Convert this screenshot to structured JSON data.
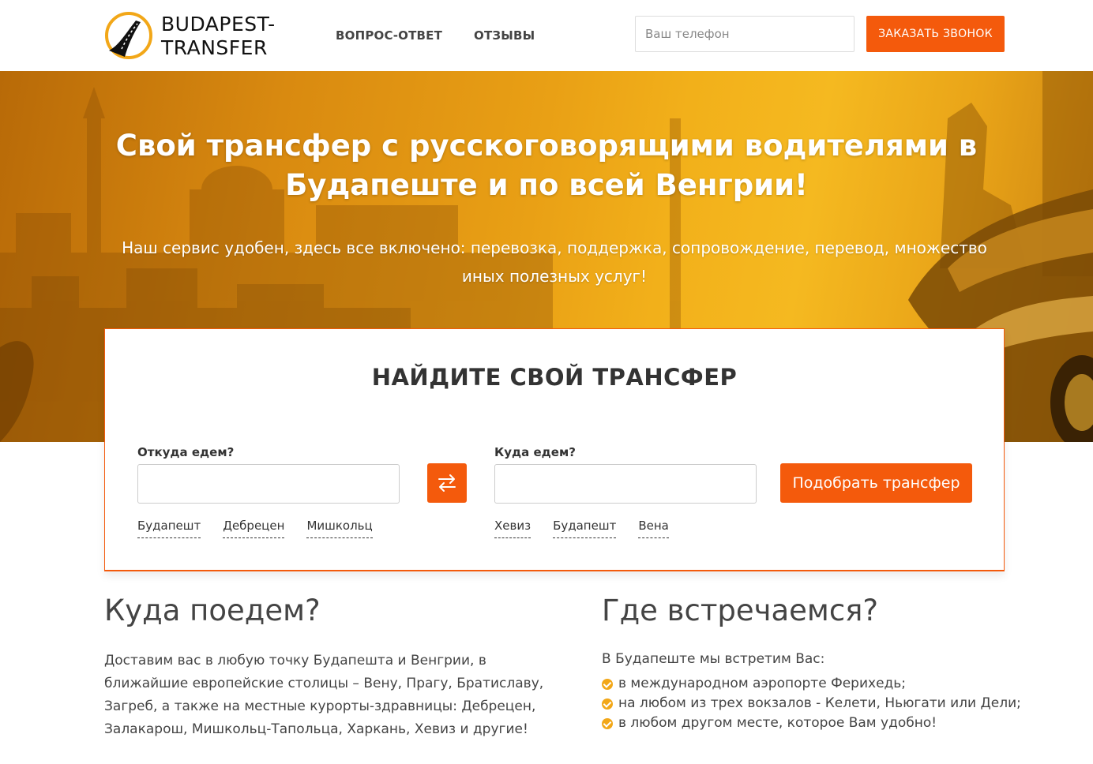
{
  "header": {
    "logo_line1": "BUDAPEST-",
    "logo_line2": "TRANSFER",
    "nav": [
      "ВОПРОС-ОТВЕТ",
      "ОТЗЫВЫ"
    ],
    "phone_placeholder": "Ваш телефон",
    "call_button": "ЗАКАЗАТЬ ЗВОНОК"
  },
  "hero": {
    "title": "Свой трансфер с русскоговорящими водителями в Будапеште и по всей Венгрии!",
    "subtitle": "Наш сервис удобен, здесь все включено: перевозка, поддержка, сопровождение, перевод, множество иных полезных услуг!"
  },
  "search": {
    "title": "НАЙДИТЕ СВОЙ ТРАНСФЕР",
    "from_label": "Откуда едем?",
    "to_label": "Куда едем?",
    "submit": "Подобрать трансфер",
    "from_quick": [
      "Будапешт",
      "Дебрецен",
      "Мишкольц"
    ],
    "to_quick": [
      "Хевиз",
      "Будапешт",
      "Вена"
    ]
  },
  "left_col": {
    "title": "Куда поедем?",
    "text": "Доставим вас в любую точку Будапешта и Венгрии, в ближайшие европейские столицы – Вену, Прагу, Братиславу, Загреб, а также на местные курорты-здравницы: Дебрецен, Залакарош, Мишкольц-Тапольца, Харкань, Хевиз и другие!"
  },
  "right_col": {
    "title": "Где встречаемся?",
    "intro": "В Будапеште мы встретим Вас:",
    "items": [
      "в международном аэропорте Ферихедь;",
      "на любом из трех вокзалов - Келети, Ньюгати или Дели;",
      "в любом другом месте, которое Вам удобно!"
    ]
  },
  "colors": {
    "accent": "#f45a0c",
    "hero": "#e9a015",
    "check": "#f2a718"
  }
}
